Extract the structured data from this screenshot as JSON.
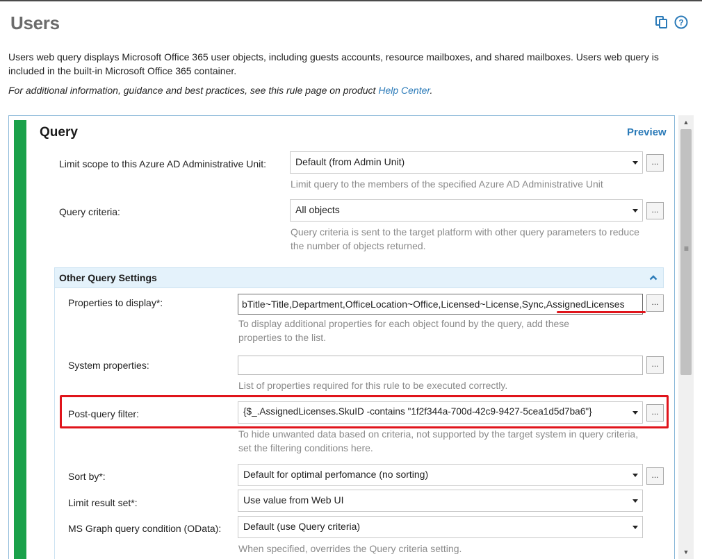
{
  "page": {
    "title": "Users",
    "description": "Users web query displays Microsoft Office 365 user objects, including guests accounts, resource mailboxes, and shared mailboxes. Users web query is included in the built-in Microsoft Office 365 container.",
    "info_prefix": "For additional information, guidance and best practices, see this rule page on product ",
    "info_link": "Help Center",
    "info_suffix": ".",
    "icons": [
      "copy-icon",
      "help-icon"
    ]
  },
  "query": {
    "title": "Query",
    "preview_label": "Preview",
    "admin_unit": {
      "label": "Limit scope to this Azure AD Administrative Unit:",
      "value": "Default (from Admin Unit)",
      "help": "Limit query to the members of the specified Azure AD Administrative Unit",
      "button": "..."
    },
    "criteria": {
      "label": "Query criteria:",
      "value": "All objects",
      "help": "Query criteria is sent to the target platform with other query parameters to reduce the number of objects returned.",
      "button": "..."
    }
  },
  "other": {
    "title": "Other Query Settings",
    "properties": {
      "label": "Properties to display*:",
      "value": "bTitle~Title,Department,OfficeLocation~Office,Licensed~License,Sync,AssignedLicenses",
      "help": "To display additional properties for each object found by the query, add these properties to the list.",
      "button": "..."
    },
    "system": {
      "label": "System properties:",
      "value": "",
      "help": "List of properties required for this rule to be executed correctly.",
      "button": "..."
    },
    "postfilter": {
      "label": "Post-query filter:",
      "value": "{$_.AssignedLicenses.SkuID -contains \"1f2f344a-700d-42c9-9427-5cea1d5d7ba6\"}",
      "help": "To hide unwanted data based on criteria, not supported by the target system in query criteria, set the filtering conditions here.",
      "button": "..."
    },
    "sortby": {
      "label": "Sort by*:",
      "value": "Default for optimal perfomance (no sorting)",
      "button": "..."
    },
    "limit": {
      "label": "Limit result set*:",
      "value": "Use value from Web UI"
    },
    "odata": {
      "label": "MS Graph query condition (OData):",
      "value": "Default (use Query criteria)",
      "help": "When specified, overrides the Query criteria setting."
    }
  },
  "colors": {
    "accent_green": "#1aa14a",
    "link_blue": "#2a7ab8",
    "highlight_red": "#e0141b",
    "subheader_bg": "#e4f2fb"
  }
}
